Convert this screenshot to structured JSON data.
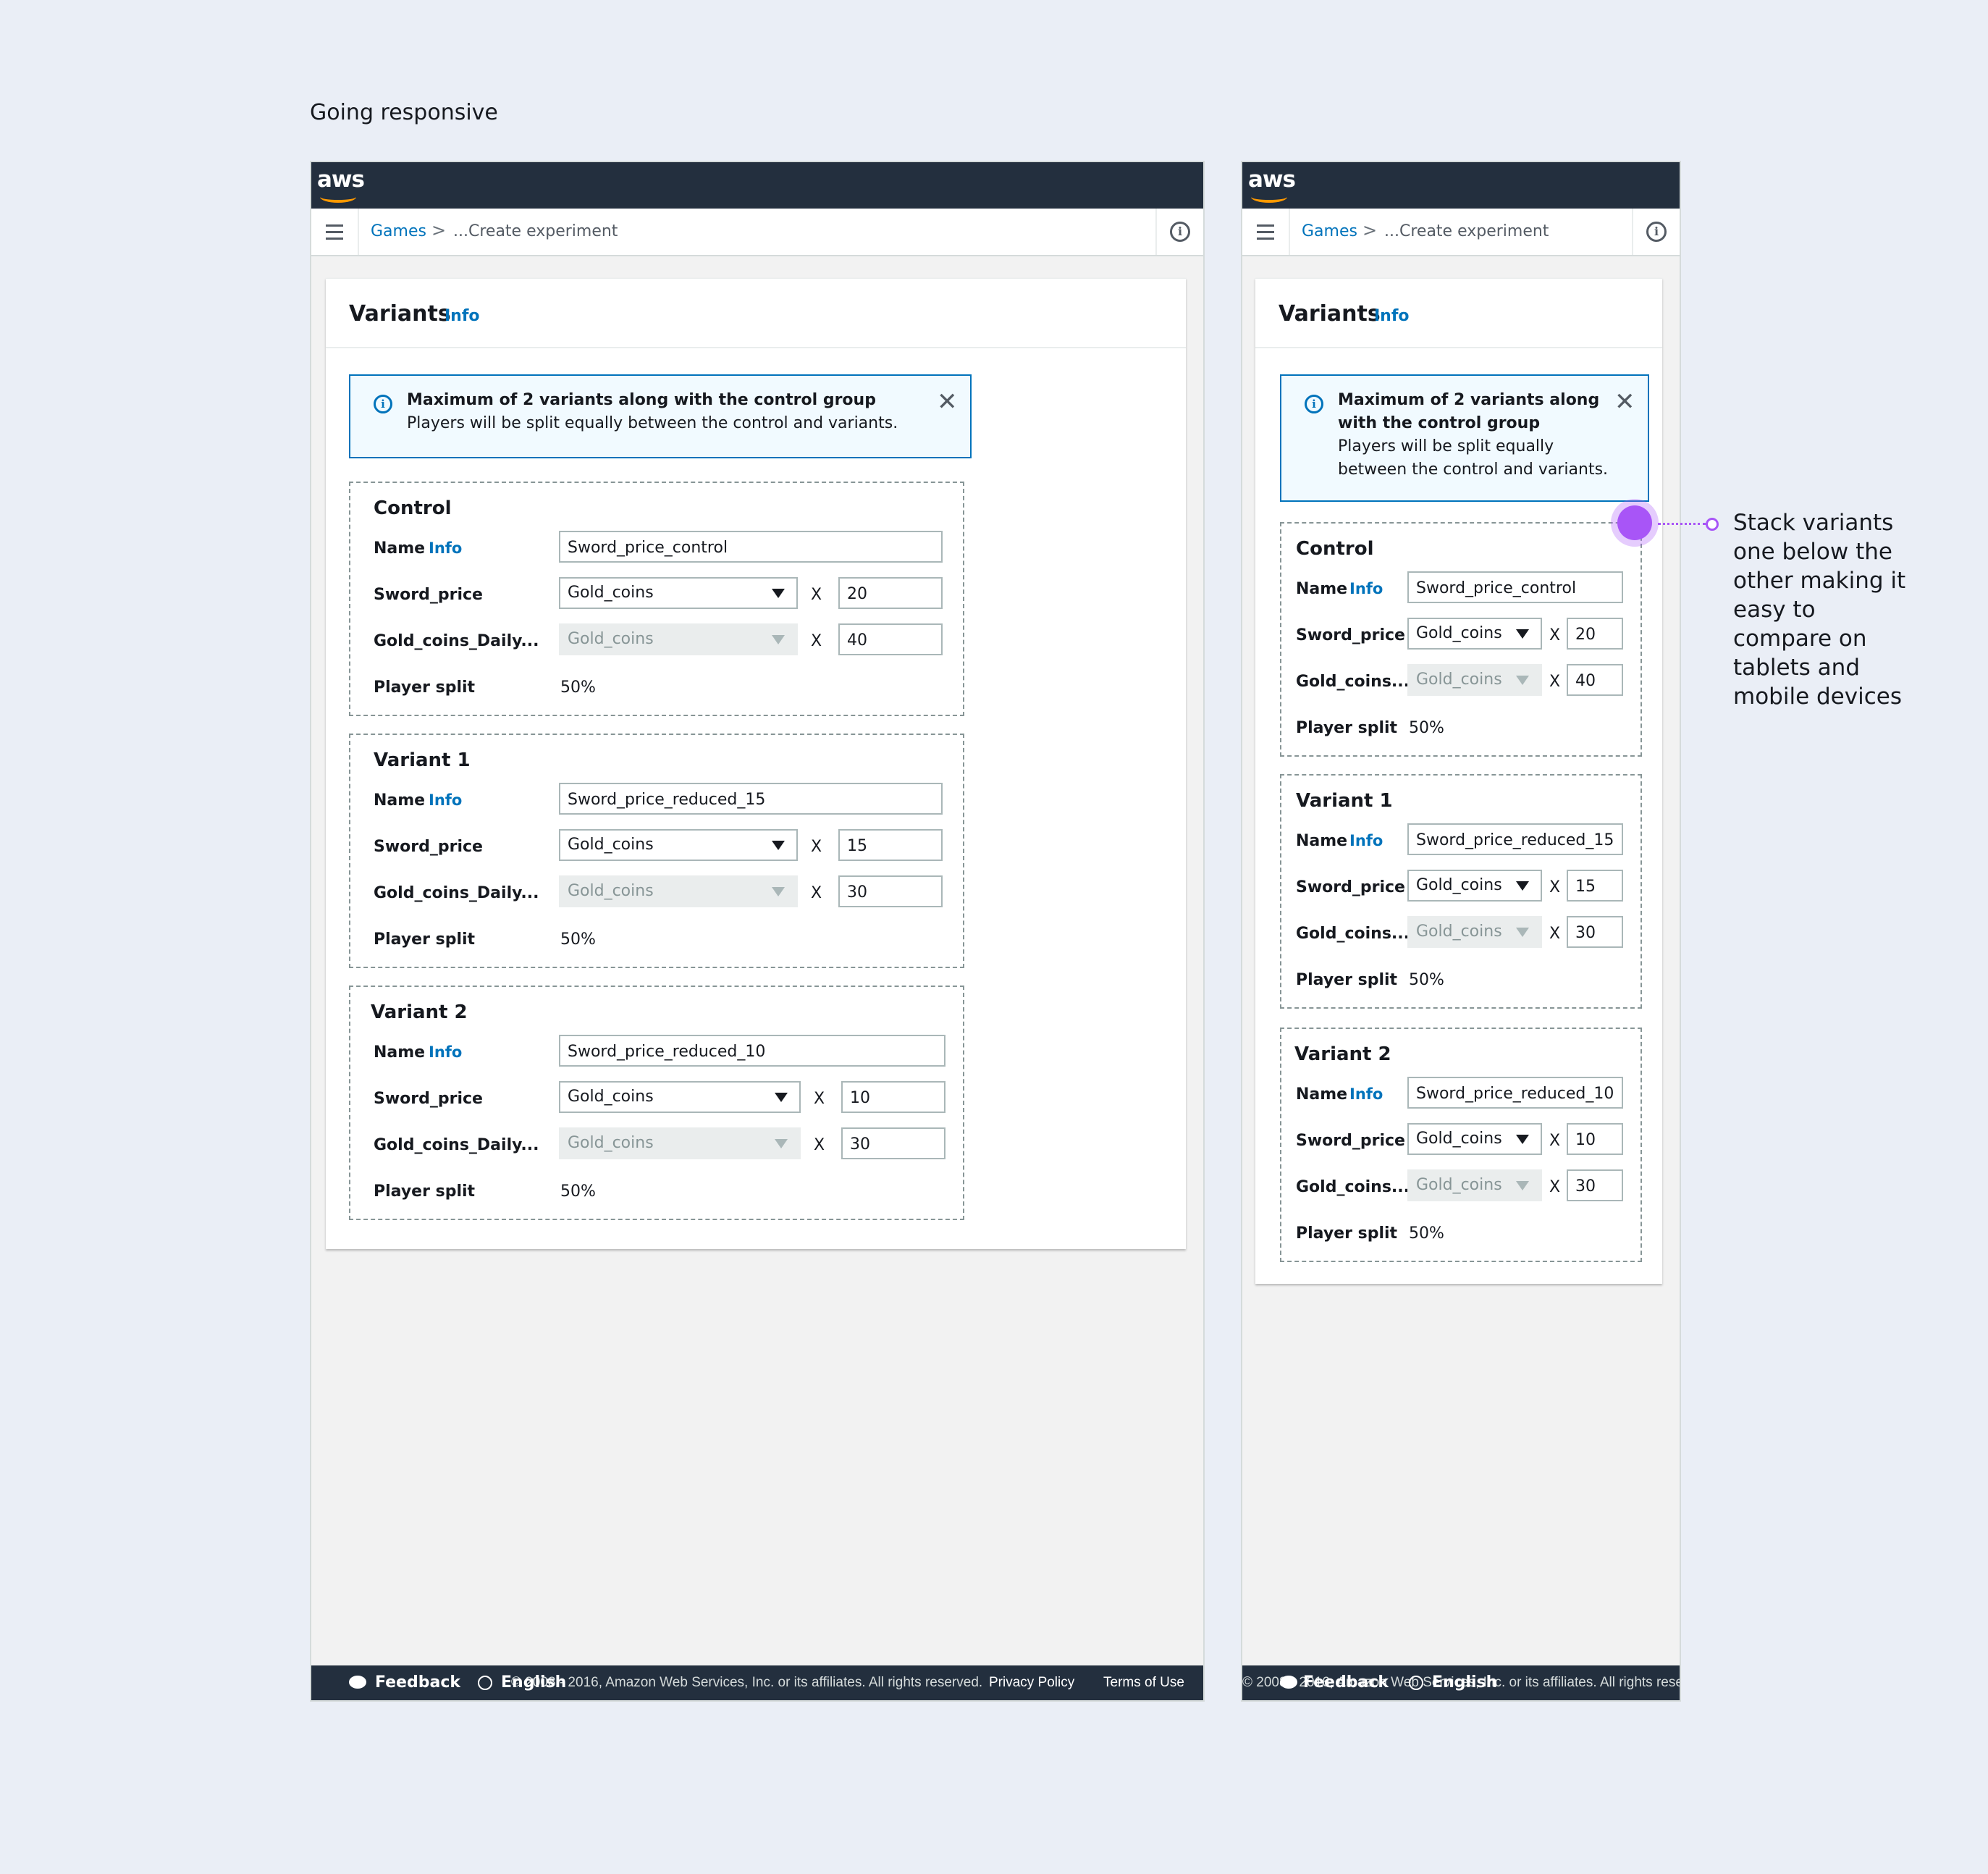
{
  "page_title": "Going responsive",
  "brand": "aws",
  "breadcrumb": {
    "root": "Games",
    "separator": ">",
    "current": "...Create experiment"
  },
  "panel": {
    "title": "Variants",
    "info": "Info"
  },
  "alert": {
    "title": "Maximum of 2 variants along with the control group",
    "body": "Players will be split equally between the control and variants.",
    "mobile_title_lines": [
      "Maximum of 2 variants along",
      "with the control group"
    ],
    "mobile_body_lines": [
      "Players will be split equally",
      "between the control and variants."
    ]
  },
  "labels": {
    "name": "Name",
    "info": "Info",
    "sword_price": "Sword_price",
    "daily": "Gold_coins_Daily...",
    "daily_short": "Gold_coins...",
    "player_split": "Player split",
    "times": "X"
  },
  "groups": [
    {
      "title": "Control",
      "name": "Sword_price_control",
      "currency": "Gold_coins",
      "price": "20",
      "daily_currency": "Gold_coins",
      "daily": "40",
      "split": "50%"
    },
    {
      "title": "Variant 1",
      "name": "Sword_price_reduced_15",
      "currency": "Gold_coins",
      "price": "15",
      "daily_currency": "Gold_coins",
      "daily": "30",
      "split": "50%"
    },
    {
      "title": "Variant 2",
      "name": "Sword_price_reduced_10",
      "currency": "Gold_coins",
      "price": "10",
      "daily_currency": "Gold_coins",
      "daily": "30",
      "split": "50%"
    }
  ],
  "footer": {
    "feedback": "Feedback",
    "language": "English",
    "copyright": "© 2008 - 2016, Amazon Web Services, Inc. or its affiliates. All rights reserved.",
    "privacy": "Privacy Policy",
    "terms": "Terms of Use"
  },
  "callout": {
    "lines": [
      "Stack variants",
      "one below the",
      "other making it",
      "easy to",
      "compare on",
      "tablets and",
      "mobile devices"
    ]
  },
  "colors": {
    "accent_link": "#0073bb",
    "header_bg": "#232f3e",
    "brand_orange": "#ff9900",
    "callout": "#a855f7",
    "alert_bg": "#f1faff"
  }
}
